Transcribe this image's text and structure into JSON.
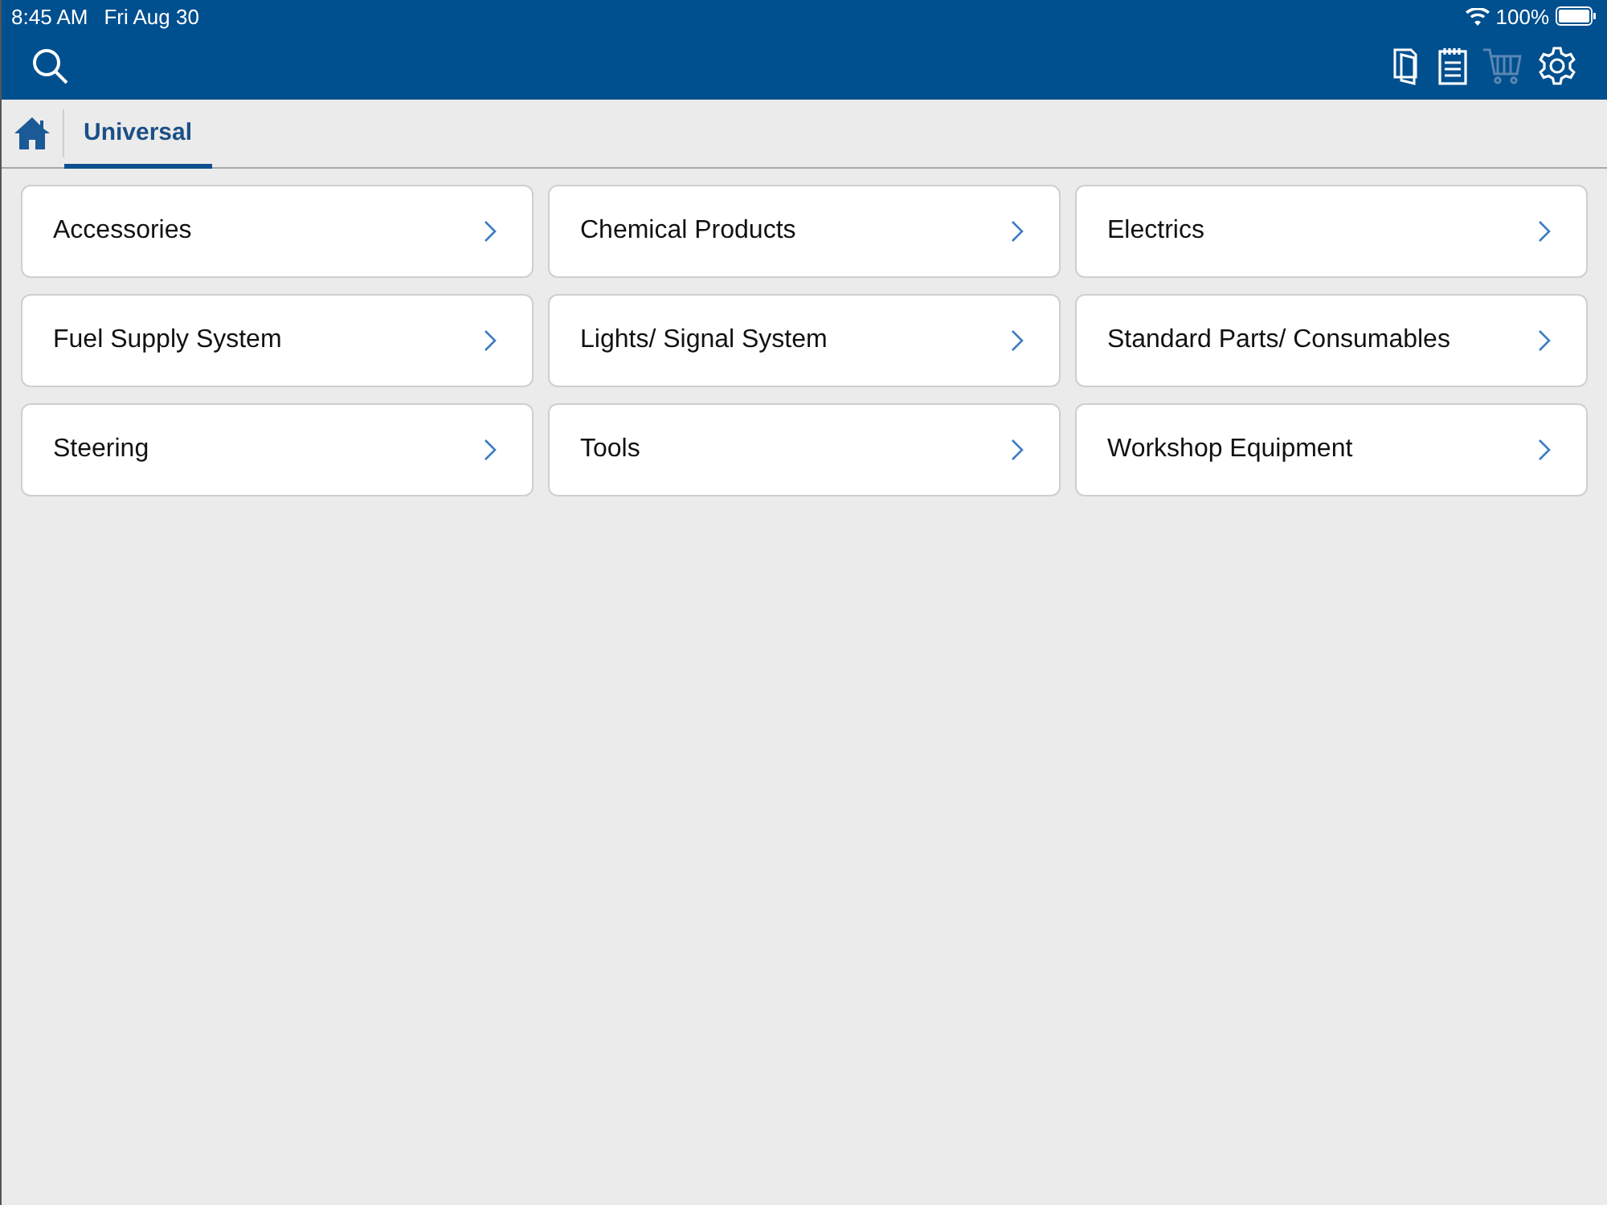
{
  "status_bar": {
    "time": "8:45 AM",
    "date": "Fri Aug 30",
    "battery": "100%"
  },
  "toolbar": [
    {
      "kind": "documents",
      "disabled": false
    },
    {
      "kind": "notepad",
      "disabled": false
    },
    {
      "kind": "cart",
      "disabled": true
    },
    {
      "kind": "settings",
      "disabled": false
    }
  ],
  "tabs": [
    {
      "label": "Universal",
      "selected": true
    }
  ],
  "categories": [
    "Accessories",
    "Chemical Products",
    "Electrics",
    "Fuel Supply System",
    "Lights/ Signal System",
    "Standard Parts/ Consumables",
    "Steering",
    "Tools",
    "Workshop Equipment"
  ]
}
